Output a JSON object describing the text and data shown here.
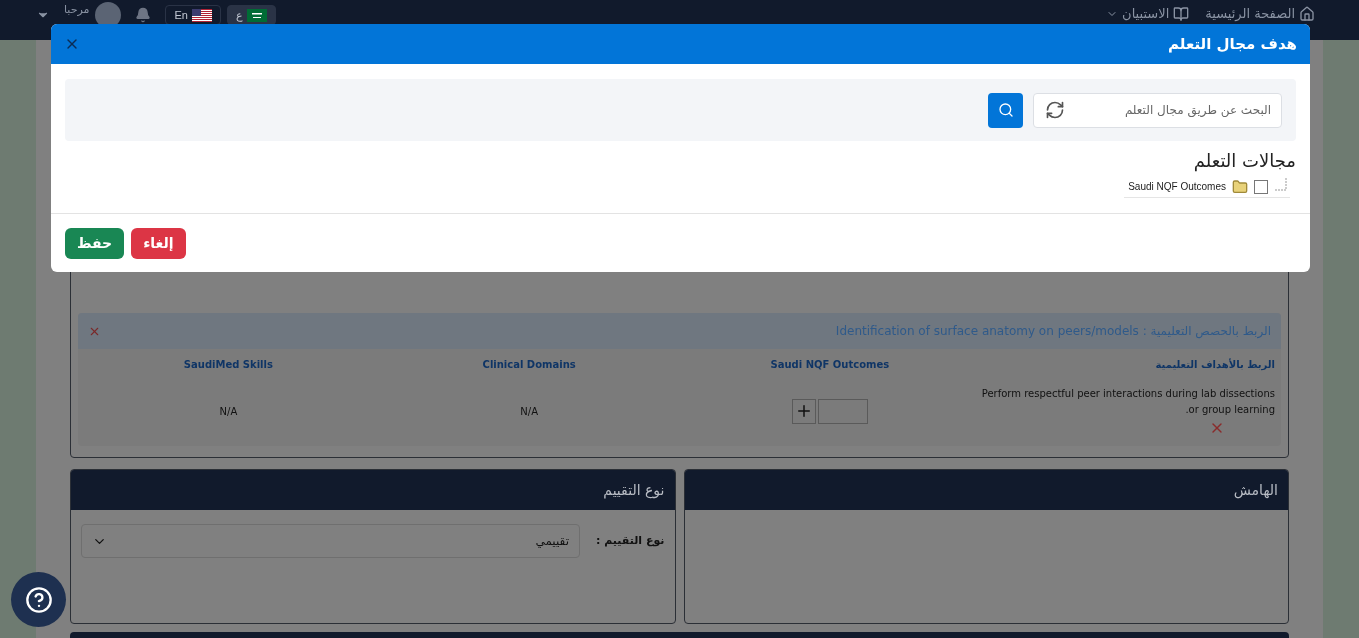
{
  "top_bar": {
    "nav": [
      {
        "label": "الصفحة الرئيسية",
        "kind": "home"
      },
      {
        "label": "الاستبيان",
        "kind": "survey"
      }
    ],
    "languages": [
      {
        "label": "ع",
        "kind": "sa",
        "selected": true
      },
      {
        "label": "En",
        "kind": "us",
        "selected": false
      }
    ],
    "greeting": "مرحبا"
  },
  "mapping_panel": {
    "title": "الربط بالحصص التعليمية : Identification of surface anatomy on peers/models",
    "columns": [
      "الربط بالأهداف التعليمية",
      "Saudi NQF Outcomes",
      "Clinical Domains",
      "SaudiMed Skills"
    ],
    "rows": [
      {
        "objective": "Perform respectful peer interactions during lab dissections or group learning.",
        "clinical_domains": "N/A",
        "saudimed_skills": "N/A"
      }
    ]
  },
  "margin_card": {
    "title": "الهامش"
  },
  "assessment_card": {
    "title": "نوع التقييم",
    "field_label": "نوع التقييم :",
    "value": "تقييمي"
  },
  "modal": {
    "title": "هدف مجال التعلم",
    "search": {
      "placeholder": "البحث عن طريق مجال التعلم"
    },
    "section_title": "مجالات التعلم",
    "tree": [
      {
        "label": "Saudi NQF Outcomes",
        "checked": false
      }
    ],
    "buttons": [
      {
        "label": "إلغاء",
        "kind": "cancel"
      },
      {
        "label": "حفظ",
        "kind": "save"
      }
    ]
  }
}
